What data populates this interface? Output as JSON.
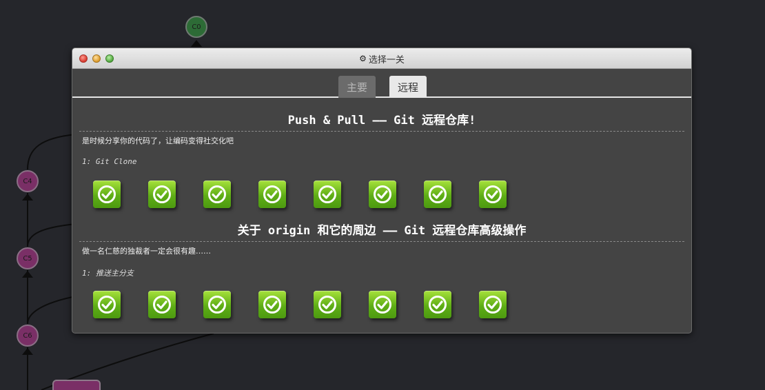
{
  "graph": {
    "commits": [
      {
        "label": "C0",
        "color": "#2d6b36"
      },
      {
        "label": "C4",
        "color": "#7a2f66"
      },
      {
        "label": "C5",
        "color": "#7a2f66"
      },
      {
        "label": "C6",
        "color": "#7a2f66"
      }
    ]
  },
  "dialog": {
    "title": "选择一关",
    "title_icon": "gear-icon",
    "tabs": [
      {
        "label": "主要",
        "selected": false
      },
      {
        "label": "远程",
        "selected": true
      }
    ],
    "sections": [
      {
        "title": "Push & Pull —— Git 远程仓库!",
        "description": "是时候分享你的代码了，让编码变得社交化吧",
        "level_name": "1: Git Clone",
        "levels_completed": 8
      },
      {
        "title": "关于 origin 和它的周边 —— Git 远程仓库高级操作",
        "description": "做一名仁慈的独裁者一定会很有趣……",
        "level_name": "1: 推送主分支",
        "levels_completed": 8
      }
    ]
  },
  "colors": {
    "background": "#25262b",
    "dialog_body": "#444444",
    "level_complete": "#6fba1d"
  }
}
